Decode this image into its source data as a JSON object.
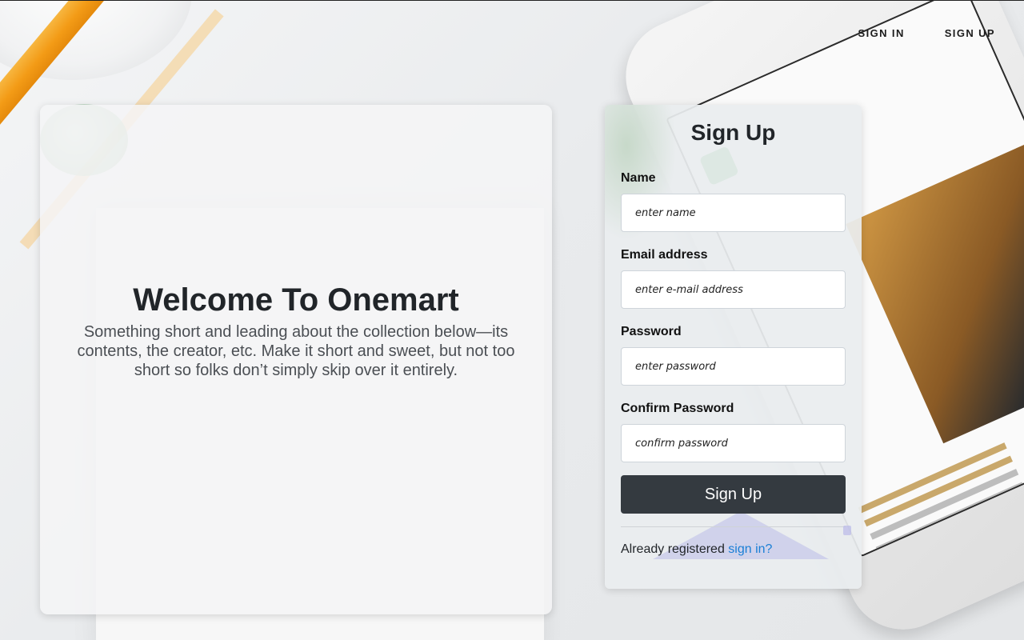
{
  "nav": {
    "sign_in": "SIGN IN",
    "sign_up": "SIGN UP"
  },
  "welcome": {
    "title": "Welcome To Onemart",
    "description": "Something short and leading about the collection below—its contents, the creator, etc. Make it short and sweet, but not too short so folks don’t simply skip over it entirely."
  },
  "signup": {
    "title": "Sign Up",
    "fields": [
      {
        "label": "Name",
        "placeholder": "enter name"
      },
      {
        "label": "Email address",
        "placeholder": "enter e-mail address"
      },
      {
        "label": "Password",
        "placeholder": "enter password"
      },
      {
        "label": "Confirm Password",
        "placeholder": "confirm password"
      }
    ],
    "submit_label": "Sign Up",
    "already_text": "Already registered",
    "signin_link": "sign in?"
  },
  "colors": {
    "button_bg": "#343a40",
    "link": "#1a7fd6"
  }
}
